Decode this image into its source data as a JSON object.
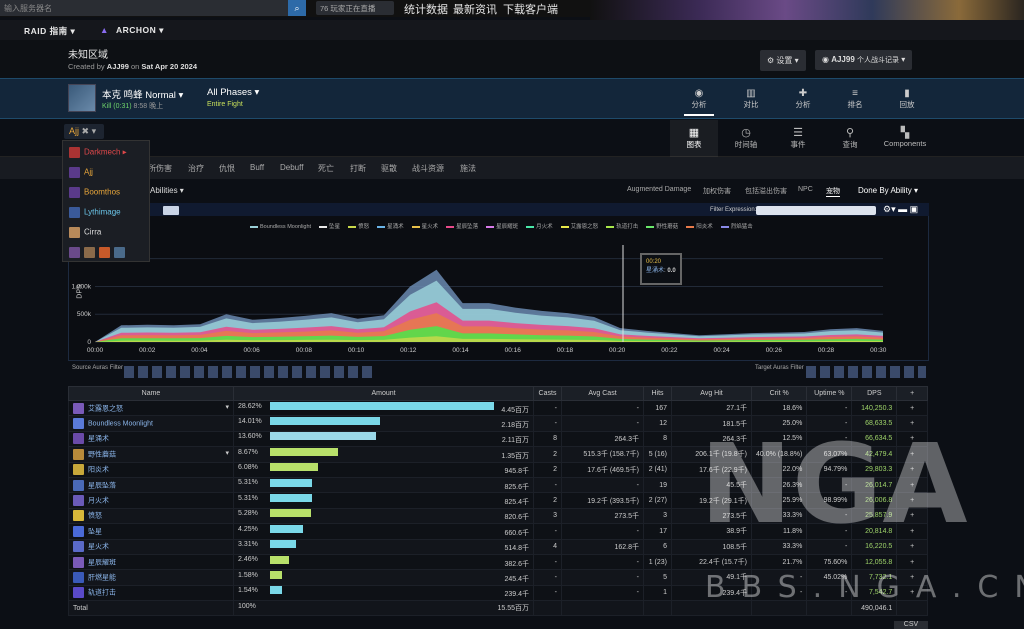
{
  "top": {
    "search_placeholder": "输入服务器名",
    "live": "76 玩家正在直播",
    "links": [
      "统计数据",
      "最新资讯",
      "下载客户端"
    ]
  },
  "nav": {
    "raid": "RAID 指南",
    "archon": "ARCHON"
  },
  "report": {
    "title": "未知区域",
    "creator_prefix": "Created by",
    "creator": "AJJ99",
    "creator_on": "on",
    "date": "Sat Apr 20 2024",
    "settings": "设置",
    "user": "AJJ99",
    "user_sub": "个人战斗记录"
  },
  "fight": {
    "boss": "本克 鸣蜂 Normal",
    "kill": "Kill (0:31)",
    "time": "8:58 晚上",
    "phases": "All Phases",
    "entire": "Entire Fight",
    "tabs": [
      "分析",
      "对比",
      "分析",
      "排名",
      "回放"
    ]
  },
  "view_tabs": [
    "图表",
    "时间轴",
    "事件",
    "查询",
    "Components"
  ],
  "player": "Ajj",
  "dropdown": [
    "Darkmech",
    "Ajj",
    "Boomthos",
    "Lythimage",
    "Cirra"
  ],
  "metric_tabs": [
    "伤害",
    "治疗",
    "仇恨",
    "Buff",
    "Debuff",
    "死亡",
    "打断",
    "驱散",
    "战斗资源",
    "施法"
  ],
  "metric_partial": "所伤害",
  "abilities": "Abilities",
  "options": [
    "Augmented Damage",
    "加权伤害",
    "包括溢出伤害",
    "NPC",
    "宠物",
    "Done By Ability"
  ],
  "filter_label": "Filter Expression:",
  "chart_data": {
    "type": "area",
    "ylabel": "DPS",
    "yticks": [
      "0",
      "500k",
      "1,000k",
      "1,500k"
    ],
    "ylim": [
      0,
      1800000
    ],
    "xticks": [
      "00:00",
      "00:02",
      "00:04",
      "00:06",
      "00:08",
      "00:10",
      "00:12",
      "00:14",
      "00:16",
      "00:18",
      "00:20",
      "00:22",
      "00:24",
      "00:26",
      "00:28",
      "00:30"
    ],
    "legend": [
      "Boundless Moonlight",
      "坠星",
      "愤怒",
      "星涌术",
      "星火术",
      "星辰坠落",
      "星辰耀斑",
      "月火术",
      "艾露恩之怒",
      "轨道打击",
      "野性蘑菇",
      "阳炎术",
      "烈焰猛击"
    ],
    "tooltip": {
      "time": "00:20",
      "label": "星涌术",
      "value": "0.0"
    },
    "total": [
      0,
      300000,
      310000,
      300000,
      320000,
      500000,
      400000,
      430000,
      470000,
      520000,
      420000,
      480000,
      1000000,
      1300000,
      700000,
      700000,
      620000,
      560000,
      520000,
      450000,
      250000,
      200000,
      160000,
      120000,
      140000,
      160000,
      170000,
      180000,
      230000,
      250000,
      200000
    ]
  },
  "source_filter": "Source Auras Filter",
  "target_filter": "Target Auras Filter",
  "table": {
    "headers": [
      "Name",
      "Amount",
      "Casts",
      "Avg Cast",
      "Hits",
      "Avg Hit",
      "Crit %",
      "Uptime %",
      "DPS"
    ],
    "rows": [
      [
        "艾露恩之怒",
        "28.62%",
        "4.45百万",
        "-",
        "-",
        "167",
        "27.1千",
        "18.6%",
        "-",
        "140,250.3"
      ],
      [
        "Boundless Moonlight",
        "14.01%",
        "2.18百万",
        "-",
        "-",
        "12",
        "181.5千",
        "25.0%",
        "-",
        "68,633.5"
      ],
      [
        "星涌术",
        "13.60%",
        "2.11百万",
        "8",
        "264.3千",
        "8",
        "264.3千",
        "12.5%",
        "-",
        "66,634.5"
      ],
      [
        "野性蘑菇",
        "8.67%",
        "1.35百万",
        "2",
        "515.3千 (158.7千)",
        "5 (16)",
        "206.1千 (19.8千)",
        "40.0% (18.8%)",
        "63.07%",
        "42,479.4"
      ],
      [
        "阳炎术",
        "6.08%",
        "945.8千",
        "2",
        "17.6千 (469.5千)",
        "2 (41)",
        "17.6千 (22.9千)",
        "22.0%",
        "94.79%",
        "29,803.3"
      ],
      [
        "星辰坠落",
        "5.31%",
        "825.6千",
        "-",
        "-",
        "19",
        "45.5千",
        "26.3%",
        "-",
        "26,014.7"
      ],
      [
        "月火术",
        "5.31%",
        "825.4千",
        "2",
        "19.2千 (393.5千)",
        "2 (27)",
        "19.2千 (29.1千)",
        "25.9%",
        "98.99%",
        "26,006.8"
      ],
      [
        "愤怒",
        "5.28%",
        "820.6千",
        "3",
        "273.5千",
        "3",
        "273.5千",
        "33.3%",
        "-",
        "25,857.9"
      ],
      [
        "坠星",
        "4.25%",
        "660.6千",
        "-",
        "-",
        "17",
        "38.9千",
        "11.8%",
        "-",
        "20,814.8"
      ],
      [
        "星火术",
        "3.31%",
        "514.8千",
        "4",
        "162.8千",
        "6",
        "108.5千",
        "33.3%",
        "-",
        "16,220.5"
      ],
      [
        "星辰耀斑",
        "2.46%",
        "382.6千",
        "-",
        "-",
        "1 (23)",
        "22.4千 (15.7千)",
        "21.7%",
        "75.60%",
        "12,055.8"
      ],
      [
        "肝燃星能",
        "1.58%",
        "245.4千",
        "-",
        "-",
        "5",
        "49.1千",
        "-",
        "45.02%",
        "7,732.1"
      ],
      [
        "轨道打击",
        "1.54%",
        "239.4千",
        "-",
        "-",
        "1",
        "239.4千",
        "-",
        "-",
        "7,542.7"
      ]
    ],
    "total": [
      "Total",
      "100%",
      "15.55百万",
      "490,046.1"
    ]
  },
  "csv": "CSV",
  "watermark": "NGA",
  "watermark_sub": "BBS.NGA.CN"
}
